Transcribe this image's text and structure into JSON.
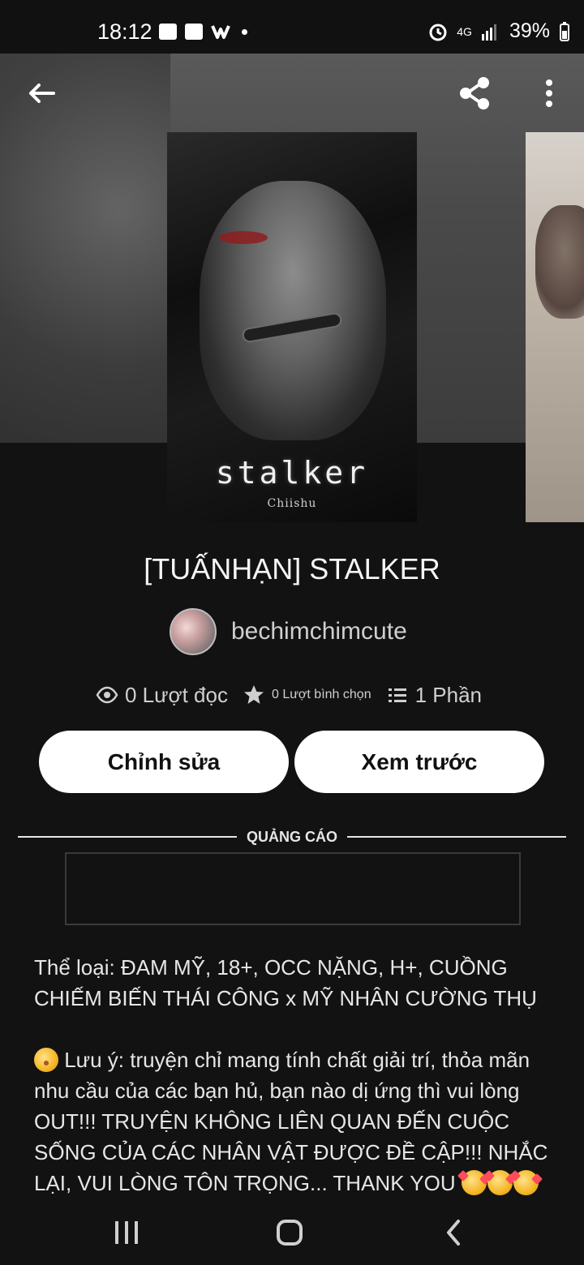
{
  "status_bar": {
    "time": "18:12",
    "battery": "39%",
    "network": "4G",
    "icons": [
      "message-icon",
      "shop-icon",
      "w-icon",
      "dot-icon",
      "alarm-icon",
      "network-icon",
      "signal-icon",
      "battery-icon"
    ]
  },
  "header": {
    "icons": [
      "back-arrow-icon",
      "share-icon",
      "more-vertical-icon"
    ]
  },
  "cover": {
    "title_text": "stalker",
    "author_text": "Chiishu"
  },
  "story": {
    "title": "[TUẤNHẠN] STALKER",
    "author": "bechimchimcute"
  },
  "stats": {
    "reads": "0 Lượt đọc",
    "votes": "0 Lượt bình chọn",
    "parts": "1 Phần"
  },
  "actions": {
    "edit": "Chỉnh sửa",
    "preview": "Xem trước"
  },
  "ads": {
    "label": "QUẢNG CÁO"
  },
  "description": {
    "line1": "Thể loại: ĐAM MỸ, 18+, OCC NẶNG, H+, CUỒNG",
    "line2": "CHIẾM BIẾN THÁI CÔNG x MỸ NHÂN CƯỜNG THỤ",
    "note_text": " Lưu ý: truyện chỉ mang tính chất giải trí, thỏa mãn nhu cầu của các bạn hủ, bạn nào dị ứng thì vui lòng OUT!!! TRUYỆN KHÔNG LIÊN QUAN ĐẾN CUỘC SỐNG CỦA CÁC NHÂN VẬT ĐƯỢC ĐỀ CẬP!!! NHẮC LẠI, VUI LÒNG TÔN TRỌNG... THANK YOU "
  },
  "navigation": {
    "icons": [
      "recents-icon",
      "home-icon",
      "back-chevron-icon"
    ]
  }
}
